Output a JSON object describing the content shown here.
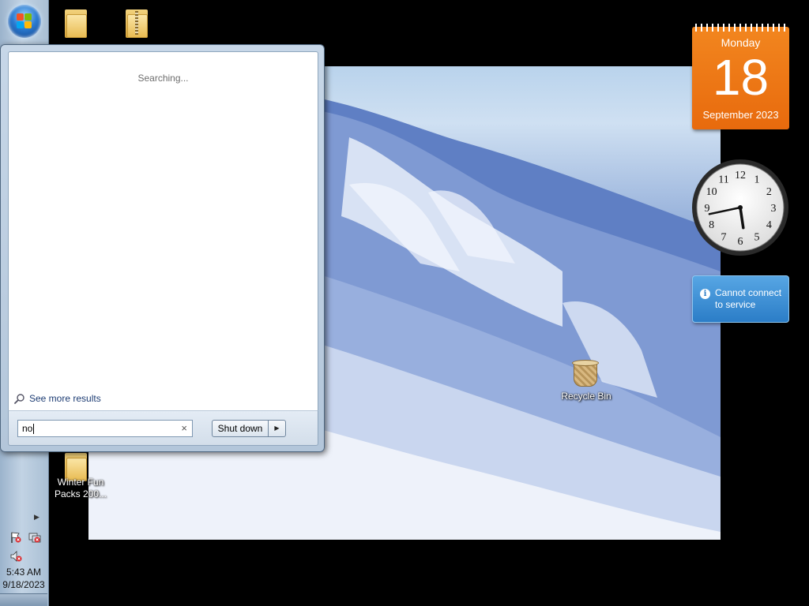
{
  "start_menu": {
    "status_text": "Searching...",
    "see_more_label": "See more results",
    "search_value": "no",
    "clear_symbol": "×",
    "shutdown_label": "Shut down",
    "shutdown_arrow": "▶"
  },
  "desktop": {
    "recycle_bin_label": "Recycle Bin",
    "winter_folder_label": "Winter Fun Packs 200..."
  },
  "taskbar": {
    "time": "5:43 AM",
    "date": "9/18/2023",
    "tray_arrow": "▶"
  },
  "gadgets": {
    "calendar": {
      "day": "Monday",
      "date": "18",
      "month": "September 2023"
    },
    "clock": {
      "hour": 5,
      "minute": 43
    },
    "weather": {
      "info_symbol": "i",
      "message": "Cannot connect to service"
    }
  },
  "colors": {
    "calendar": "#ee7716",
    "weather": "#3b8fd6",
    "start_orb": "#2b7bd1"
  }
}
